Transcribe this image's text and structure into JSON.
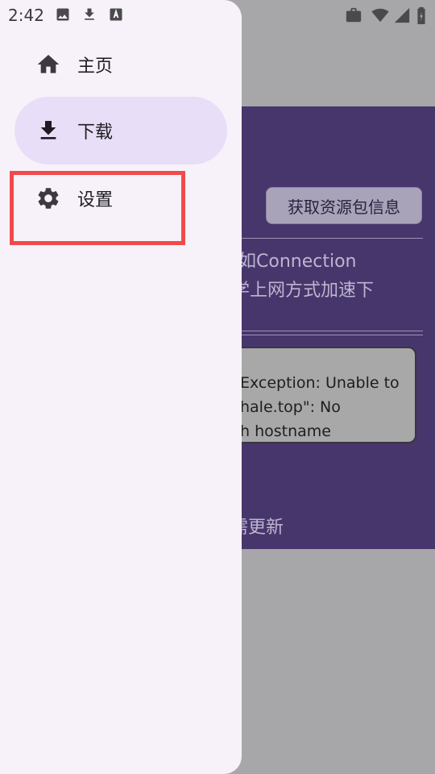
{
  "status_bar": {
    "time": "2:42",
    "icons": [
      "image-icon",
      "download-icon",
      "font-icon",
      "work-icon",
      "wifi-icon",
      "signal-icon",
      "battery-icon"
    ]
  },
  "drawer": {
    "items": [
      {
        "label": "主页",
        "icon": "home-icon",
        "active": false
      },
      {
        "label": "下载",
        "icon": "download-icon",
        "active": true
      },
      {
        "label": "设置",
        "icon": "gear-icon",
        "active": false
      }
    ]
  },
  "background": {
    "fetch_button_label": "获取资源包信息",
    "text_line_1": "如Connection",
    "text_line_2": "学上网方式加速下",
    "error_lines": [
      "Exception: Unable to",
      "hale.top\": No",
      "h hostname"
    ],
    "update_text": "需更新"
  },
  "colors": {
    "drawer_bg": "#f7f2f9",
    "active_item_bg": "#e8def7",
    "panel_bg": "#47366b",
    "highlight_border": "#f24a4a"
  }
}
